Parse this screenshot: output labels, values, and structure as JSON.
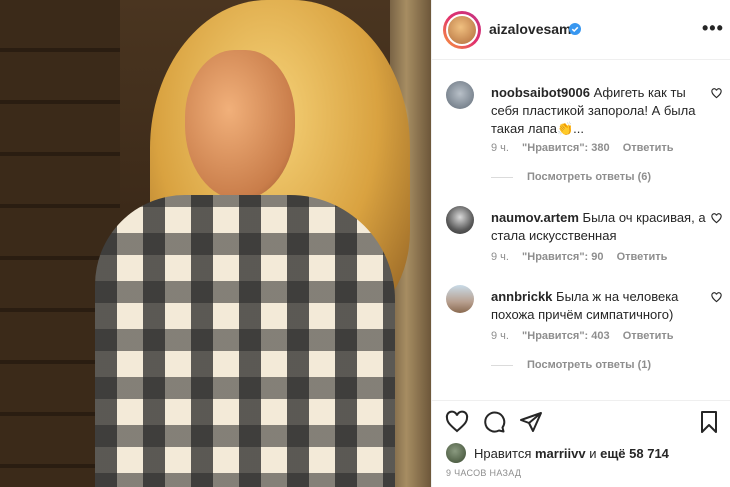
{
  "post": {
    "author": "aizalovesam",
    "more_label": "•••"
  },
  "comments": [
    {
      "username": "noobsaibot9006",
      "text": "Афигеть как ты себя пластикой запорола! А была такая лапа",
      "emoji": "👏",
      "ellipsis": "...",
      "time": "9 ч.",
      "likes": "\"Нравится\": 380",
      "reply": "Ответить",
      "replies": "Посмотреть ответы (6)"
    },
    {
      "username": "naumov.artem",
      "text": "Была оч красивая, а стала искусственная",
      "time": "9 ч.",
      "likes": "\"Нравится\": 90",
      "reply": "Ответить"
    },
    {
      "username": "annbrickk",
      "text": "Была ж на человека похожа причём симпатичного)",
      "time": "9 ч.",
      "likes": "\"Нравится\": 403",
      "reply": "Ответить",
      "replies": "Посмотреть ответы (1)"
    }
  ],
  "footer": {
    "likes_prefix": "Нравится",
    "liked_by": "marriivv",
    "likes_and": "и",
    "likes_rest": "ещё 58 714",
    "timestamp": "9 ЧАСОВ НАЗАД"
  },
  "colors": {
    "verified": "#3897f0",
    "muted": "#8e8e8e",
    "text": "#262626"
  },
  "icons": [
    "verified-icon",
    "more-icon",
    "heart-icon",
    "comment-icon",
    "share-icon",
    "bookmark-icon"
  ]
}
